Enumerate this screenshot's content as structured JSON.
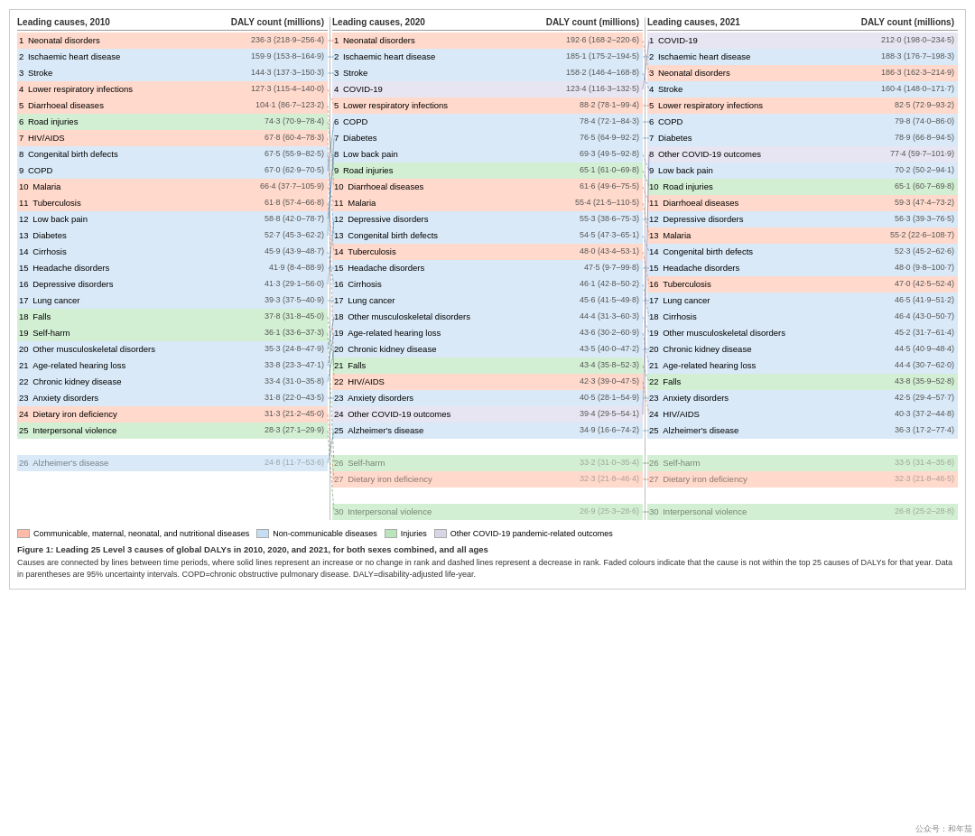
{
  "figure": {
    "title": "Figure 1: Leading 25 Level 3 causes of global DALYs in 2010, 2020, and 2021, for both sexes combined, and all ages",
    "caption": "Causes are connected by lines between time periods, where solid lines represent an increase or no change in rank and dashed lines represent a decrease in rank. Faded colours indicate that the cause is not within the top 25 causes of DALYs for that year. Data in parentheses are 95% uncertainty intervals. COPD=chronic obstructive pulmonary disease. DALY=disability-adjusted life-year.",
    "legend": [
      {
        "label": "Communicable, maternal, neonatal, and nutritional diseases",
        "color": "rgba(255,140,110,0.6)"
      },
      {
        "label": "Non-communicable diseases",
        "color": "rgba(160,200,235,0.6)"
      },
      {
        "label": "Injuries",
        "color": "rgba(140,210,140,0.6)"
      },
      {
        "label": "Other COVID-19 pandemic-related outcomes",
        "color": "rgba(190,185,215,0.6)"
      }
    ],
    "years": [
      {
        "label": "Leading causes, 2010",
        "daly_label": "DALY count (millions)",
        "rows": [
          {
            "rank": "1",
            "cause": "Neonatal disorders",
            "daly": "236·3 (218·9–256·4)",
            "cat": "communicable"
          },
          {
            "rank": "2",
            "cause": "Ischaemic heart disease",
            "daly": "159·9 (153·8–164·9)",
            "cat": "noncommunicable"
          },
          {
            "rank": "3",
            "cause": "Stroke",
            "daly": "144·3 (137·3–150·3)",
            "cat": "noncommunicable"
          },
          {
            "rank": "4",
            "cause": "Lower respiratory infections",
            "daly": "127·3 (115·4–140·0)",
            "cat": "communicable"
          },
          {
            "rank": "5",
            "cause": "Diarrhoeal diseases",
            "daly": "104·1 (86·7–123·2)",
            "cat": "communicable"
          },
          {
            "rank": "6",
            "cause": "Road injuries",
            "daly": "74·3 (70·9–78·4)",
            "cat": "injury"
          },
          {
            "rank": "7",
            "cause": "HIV/AIDS",
            "daly": "67·8 (60·4–78·3)",
            "cat": "communicable"
          },
          {
            "rank": "8",
            "cause": "Congenital birth defects",
            "daly": "67·5 (55·9–82·5)",
            "cat": "noncommunicable"
          },
          {
            "rank": "9",
            "cause": "COPD",
            "daly": "67·0 (62·9–70·5)",
            "cat": "noncommunicable"
          },
          {
            "rank": "10",
            "cause": "Malaria",
            "daly": "66·4 (37·7–105·9)",
            "cat": "communicable"
          },
          {
            "rank": "11",
            "cause": "Tuberculosis",
            "daly": "61·8 (57·4–66·8)",
            "cat": "communicable"
          },
          {
            "rank": "12",
            "cause": "Low back pain",
            "daly": "58·8 (42·0–78·7)",
            "cat": "noncommunicable"
          },
          {
            "rank": "13",
            "cause": "Diabetes",
            "daly": "52·7 (45·3–62·2)",
            "cat": "noncommunicable"
          },
          {
            "rank": "14",
            "cause": "Cirrhosis",
            "daly": "45·9 (43·9–48·7)",
            "cat": "noncommunicable"
          },
          {
            "rank": "15",
            "cause": "Headache disorders",
            "daly": "41·9 (8·4–88·9)",
            "cat": "noncommunicable"
          },
          {
            "rank": "16",
            "cause": "Depressive disorders",
            "daly": "41·3 (29·1–56·0)",
            "cat": "noncommunicable"
          },
          {
            "rank": "17",
            "cause": "Lung cancer",
            "daly": "39·3 (37·5–40·9)",
            "cat": "noncommunicable"
          },
          {
            "rank": "18",
            "cause": "Falls",
            "daly": "37·8 (31·8–45·0)",
            "cat": "injury"
          },
          {
            "rank": "19",
            "cause": "Self-harm",
            "daly": "36·1 (33·6–37·3)",
            "cat": "injury"
          },
          {
            "rank": "20",
            "cause": "Other musculoskeletal disorders",
            "daly": "35·3 (24·8–47·9)",
            "cat": "noncommunicable"
          },
          {
            "rank": "21",
            "cause": "Age-related hearing loss",
            "daly": "33·8 (23·3–47·1)",
            "cat": "noncommunicable"
          },
          {
            "rank": "22",
            "cause": "Chronic kidney disease",
            "daly": "33·4 (31·0–35·8)",
            "cat": "noncommunicable"
          },
          {
            "rank": "23",
            "cause": "Anxiety disorders",
            "daly": "31·8 (22·0–43·5)",
            "cat": "noncommunicable"
          },
          {
            "rank": "24",
            "cause": "Dietary iron deficiency",
            "daly": "31·3 (21·2–45·0)",
            "cat": "communicable"
          },
          {
            "rank": "25",
            "cause": "Interpersonal violence",
            "daly": "28·3 (27·1–29·9)",
            "cat": "injury"
          },
          {
            "rank": "",
            "cause": "",
            "daly": "",
            "cat": "spacer"
          },
          {
            "rank": "26",
            "cause": "Alzheimer's disease",
            "daly": "24·8 (11·7–53·6)",
            "cat": "noncommunicable",
            "faded": true
          }
        ]
      },
      {
        "label": "Leading causes, 2020",
        "daly_label": "DALY count (millions)",
        "rows": [
          {
            "rank": "1",
            "cause": "Neonatal disorders",
            "daly": "192·6 (168·2–220·6)",
            "cat": "communicable"
          },
          {
            "rank": "2",
            "cause": "Ischaemic heart disease",
            "daly": "185·1 (175·2–194·5)",
            "cat": "noncommunicable"
          },
          {
            "rank": "3",
            "cause": "Stroke",
            "daly": "158·2 (146·4–168·8)",
            "cat": "noncommunicable"
          },
          {
            "rank": "4",
            "cause": "COVID-19",
            "daly": "123·4 (116·3–132·5)",
            "cat": "covid"
          },
          {
            "rank": "5",
            "cause": "Lower respiratory infections",
            "daly": "88·2 (78·1–99·4)",
            "cat": "communicable"
          },
          {
            "rank": "6",
            "cause": "COPD",
            "daly": "78·4 (72·1–84·3)",
            "cat": "noncommunicable"
          },
          {
            "rank": "7",
            "cause": "Diabetes",
            "daly": "76·5 (64·9–92·2)",
            "cat": "noncommunicable"
          },
          {
            "rank": "8",
            "cause": "Low back pain",
            "daly": "69·3 (49·5–92·8)",
            "cat": "noncommunicable"
          },
          {
            "rank": "9",
            "cause": "Road injuries",
            "daly": "65·1 (61·0–69·8)",
            "cat": "injury"
          },
          {
            "rank": "10",
            "cause": "Diarrhoeal diseases",
            "daly": "61·6 (49·6–75·5)",
            "cat": "communicable"
          },
          {
            "rank": "11",
            "cause": "Malaria",
            "daly": "55·4 (21·5–110·5)",
            "cat": "communicable"
          },
          {
            "rank": "12",
            "cause": "Depressive disorders",
            "daly": "55·3 (38·6–75·3)",
            "cat": "noncommunicable"
          },
          {
            "rank": "13",
            "cause": "Congenital birth defects",
            "daly": "54·5 (47·3–65·1)",
            "cat": "noncommunicable"
          },
          {
            "rank": "14",
            "cause": "Tuberculosis",
            "daly": "48·0 (43·4–53·1)",
            "cat": "communicable"
          },
          {
            "rank": "15",
            "cause": "Headache disorders",
            "daly": "47·5 (9·7–99·8)",
            "cat": "noncommunicable"
          },
          {
            "rank": "16",
            "cause": "Cirrhosis",
            "daly": "46·1 (42·8–50·2)",
            "cat": "noncommunicable"
          },
          {
            "rank": "17",
            "cause": "Lung cancer",
            "daly": "45·6 (41·5–49·8)",
            "cat": "noncommunicable"
          },
          {
            "rank": "18",
            "cause": "Other musculoskeletal disorders",
            "daly": "44·4 (31·3–60·3)",
            "cat": "noncommunicable"
          },
          {
            "rank": "19",
            "cause": "Age-related hearing loss",
            "daly": "43·6 (30·2–60·9)",
            "cat": "noncommunicable"
          },
          {
            "rank": "20",
            "cause": "Chronic kidney disease",
            "daly": "43·5 (40·0–47·2)",
            "cat": "noncommunicable"
          },
          {
            "rank": "21",
            "cause": "Falls",
            "daly": "43·4 (35·8–52·3)",
            "cat": "injury"
          },
          {
            "rank": "22",
            "cause": "HIV/AIDS",
            "daly": "42·3 (39·0–47·5)",
            "cat": "communicable"
          },
          {
            "rank": "23",
            "cause": "Anxiety disorders",
            "daly": "40·5 (28·1–54·9)",
            "cat": "noncommunicable"
          },
          {
            "rank": "24",
            "cause": "Other COVID-19 outcomes",
            "daly": "39·4 (29·5–54·1)",
            "cat": "covid"
          },
          {
            "rank": "25",
            "cause": "Alzheimer's disease",
            "daly": "34·9 (16·6–74·2)",
            "cat": "noncommunicable"
          },
          {
            "rank": "",
            "cause": "",
            "daly": "",
            "cat": "spacer"
          },
          {
            "rank": "26",
            "cause": "Self-harm",
            "daly": "33·2 (31·0–35·4)",
            "cat": "injury",
            "faded": true
          },
          {
            "rank": "27",
            "cause": "Dietary iron deficiency",
            "daly": "32·3 (21·8–46·4)",
            "cat": "communicable",
            "faded": true
          },
          {
            "rank": "",
            "cause": "",
            "daly": "",
            "cat": "spacer"
          },
          {
            "rank": "30",
            "cause": "Interpersonal violence",
            "daly": "26·9 (25·3–28·6)",
            "cat": "injury",
            "faded": true
          }
        ]
      },
      {
        "label": "Leading causes, 2021",
        "daly_label": "DALY count (millions)",
        "rows": [
          {
            "rank": "1",
            "cause": "COVID-19",
            "daly": "212·0 (198·0–234·5)",
            "cat": "covid"
          },
          {
            "rank": "2",
            "cause": "Ischaemic heart disease",
            "daly": "188·3 (176·7–198·3)",
            "cat": "noncommunicable"
          },
          {
            "rank": "3",
            "cause": "Neonatal disorders",
            "daly": "186·3 (162·3–214·9)",
            "cat": "communicable"
          },
          {
            "rank": "4",
            "cause": "Stroke",
            "daly": "160·4 (148·0–171·7)",
            "cat": "noncommunicable"
          },
          {
            "rank": "5",
            "cause": "Lower respiratory infections",
            "daly": "82·5 (72·9–93·2)",
            "cat": "communicable"
          },
          {
            "rank": "6",
            "cause": "COPD",
            "daly": "79·8 (74·0–86·0)",
            "cat": "noncommunicable"
          },
          {
            "rank": "7",
            "cause": "Diabetes",
            "daly": "78·9 (66·8–94·5)",
            "cat": "noncommunicable"
          },
          {
            "rank": "8",
            "cause": "Other COVID-19 outcomes",
            "daly": "77·4 (59·7–101·9)",
            "cat": "covid"
          },
          {
            "rank": "9",
            "cause": "Low back pain",
            "daly": "70·2 (50·2–94·1)",
            "cat": "noncommunicable"
          },
          {
            "rank": "10",
            "cause": "Road injuries",
            "daly": "65·1 (60·7–69·8)",
            "cat": "injury"
          },
          {
            "rank": "11",
            "cause": "Diarrhoeal diseases",
            "daly": "59·3 (47·4–73·2)",
            "cat": "communicable"
          },
          {
            "rank": "12",
            "cause": "Depressive disorders",
            "daly": "56·3 (39·3–76·5)",
            "cat": "noncommunicable"
          },
          {
            "rank": "13",
            "cause": "Malaria",
            "daly": "55·2 (22·6–108·7)",
            "cat": "communicable"
          },
          {
            "rank": "14",
            "cause": "Congenital birth defects",
            "daly": "52·3 (45·2–62·6)",
            "cat": "noncommunicable"
          },
          {
            "rank": "15",
            "cause": "Headache disorders",
            "daly": "48·0 (9·8–100·7)",
            "cat": "noncommunicable"
          },
          {
            "rank": "16",
            "cause": "Tuberculosis",
            "daly": "47·0 (42·5–52·4)",
            "cat": "communicable"
          },
          {
            "rank": "17",
            "cause": "Lung cancer",
            "daly": "46·5 (41·9–51·2)",
            "cat": "noncommunicable"
          },
          {
            "rank": "18",
            "cause": "Cirrhosis",
            "daly": "46·4 (43·0–50·7)",
            "cat": "noncommunicable"
          },
          {
            "rank": "19",
            "cause": "Other musculoskeletal disorders",
            "daly": "45·2 (31·7–61·4)",
            "cat": "noncommunicable"
          },
          {
            "rank": "20",
            "cause": "Chronic kidney disease",
            "daly": "44·5 (40·9–48·4)",
            "cat": "noncommunicable"
          },
          {
            "rank": "21",
            "cause": "Age-related hearing loss",
            "daly": "44·4 (30·7–62·0)",
            "cat": "noncommunicable"
          },
          {
            "rank": "22",
            "cause": "Falls",
            "daly": "43·8 (35·9–52·8)",
            "cat": "injury"
          },
          {
            "rank": "23",
            "cause": "Anxiety disorders",
            "daly": "42·5 (29·4–57·7)",
            "cat": "noncommunicable"
          },
          {
            "rank": "24",
            "cause": "HIV/AIDS",
            "daly": "40·3 (37·2–44·8)",
            "cat": "noncommunicable"
          },
          {
            "rank": "25",
            "cause": "Alzheimer's disease",
            "daly": "36·3 (17·2–77·4)",
            "cat": "noncommunicable"
          },
          {
            "rank": "",
            "cause": "",
            "daly": "",
            "cat": "spacer"
          },
          {
            "rank": "26",
            "cause": "Self-harm",
            "daly": "33·5 (31·4–35·8)",
            "cat": "injury",
            "faded": true
          },
          {
            "rank": "27",
            "cause": "Dietary iron deficiency",
            "daly": "32·3 (21·8–46·5)",
            "cat": "communicable",
            "faded": true
          },
          {
            "rank": "",
            "cause": "",
            "daly": "",
            "cat": "spacer"
          },
          {
            "rank": "30",
            "cause": "Interpersonal violence",
            "daly": "26·8 (25·2–28·8)",
            "cat": "injury",
            "faded": true
          }
        ]
      }
    ]
  }
}
